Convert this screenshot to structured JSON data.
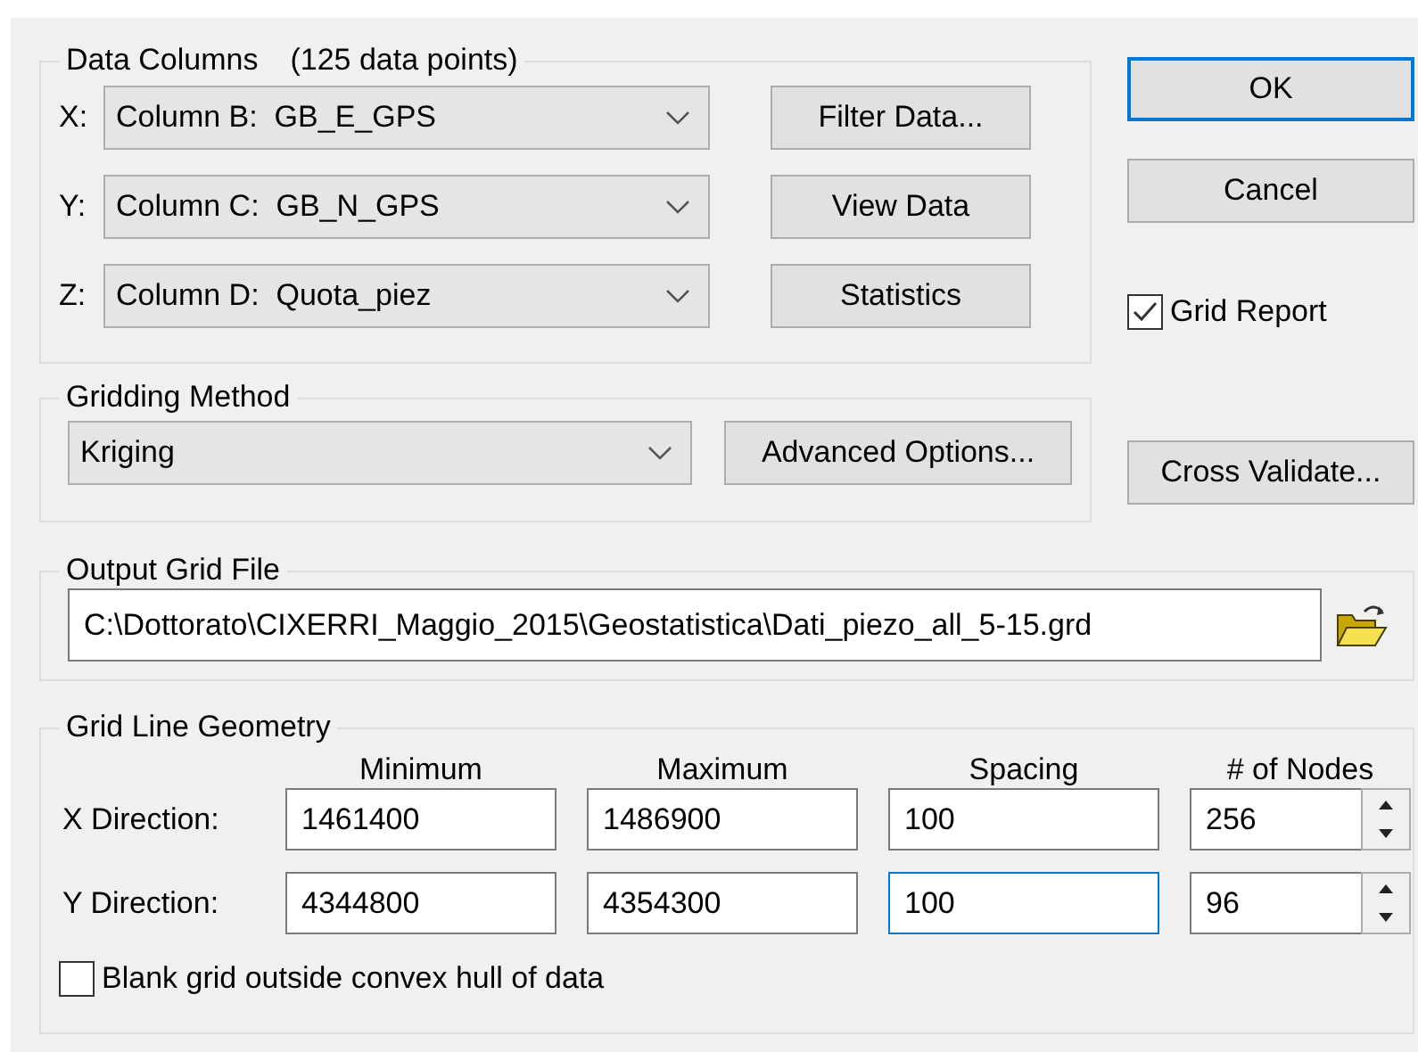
{
  "data_columns": {
    "title": "Data Columns",
    "count": "(125 data points)",
    "rows": [
      {
        "label": "X:",
        "value": "Column B:  GB_E_GPS",
        "button": "Filter Data..."
      },
      {
        "label": "Y:",
        "value": "Column C:  GB_N_GPS",
        "button": "View Data"
      },
      {
        "label": "Z:",
        "value": "Column D:  Quota_piez",
        "button": "Statistics"
      }
    ]
  },
  "dialog_buttons": [
    {
      "label": "OK",
      "focused": true
    },
    {
      "label": "Cancel",
      "focused": false
    }
  ],
  "grid_report": {
    "label": "Grid Report",
    "checked": true
  },
  "gridding_method": {
    "title": "Gridding Method",
    "value": "Kriging",
    "button": "Advanced Options..."
  },
  "cross_validate": "Cross Validate...",
  "output_grid_file": {
    "title": "Output Grid File",
    "value": "C:\\Dottorato\\CIXERRI_Maggio_2015\\Geostatistica\\Dati_piezo_all_5-15.grd"
  },
  "grid_line_geometry": {
    "title": "Grid Line Geometry",
    "columns": [
      "Minimum",
      "Maximum",
      "Spacing",
      "# of Nodes"
    ],
    "rows": [
      {
        "label": "X Direction:",
        "minimum": "1461400",
        "maximum": "1486900",
        "spacing": "100",
        "nodes": "256",
        "spacing_focused": false
      },
      {
        "label": "Y Direction:",
        "minimum": "4344800",
        "maximum": "4354300",
        "spacing": "100",
        "nodes": "96",
        "spacing_focused": true
      }
    ],
    "blank_hull": {
      "label": "Blank grid outside convex hull of data",
      "checked": false
    }
  }
}
